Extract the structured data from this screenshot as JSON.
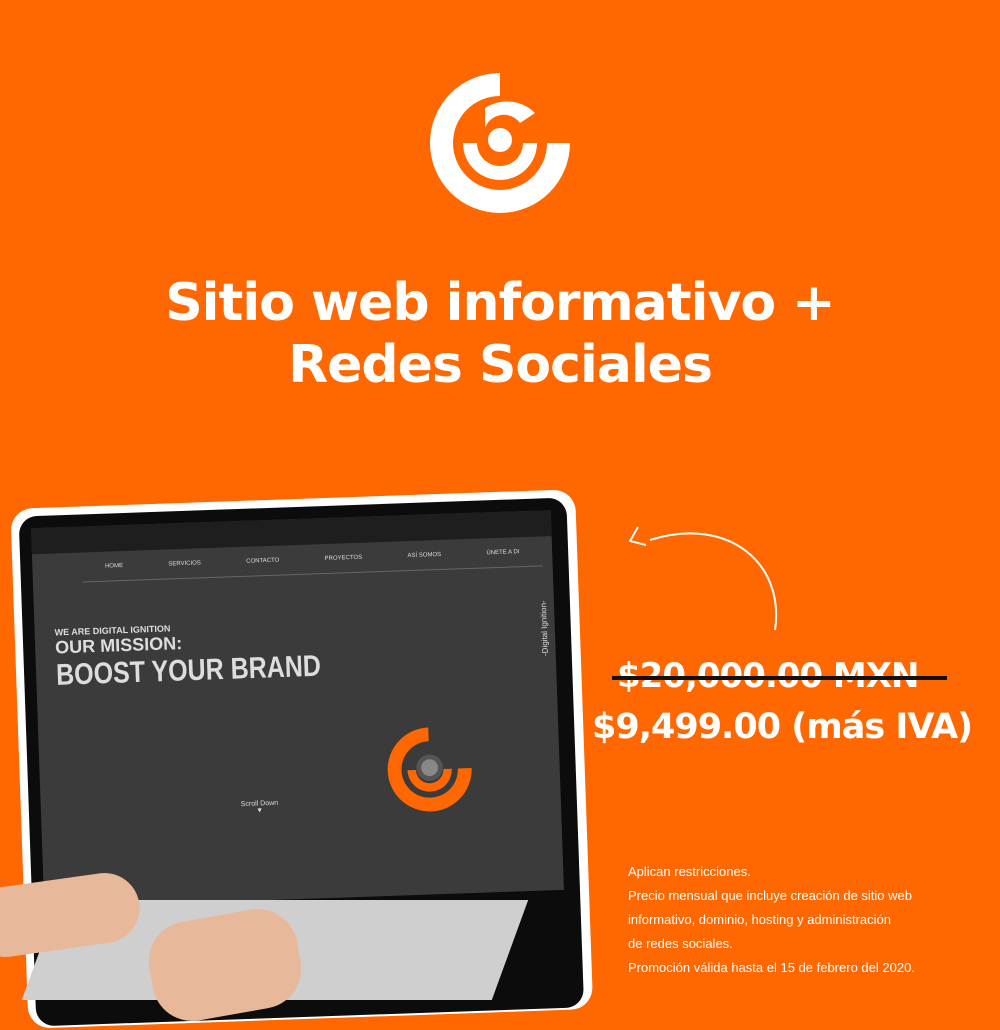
{
  "brand": {
    "color": "#ff6700",
    "logo": "digital-ignition-logo"
  },
  "headline": {
    "line1": "Sitio web informativo +",
    "line2": "Redes Sociales"
  },
  "laptop_site": {
    "nav": [
      "HOME",
      "SERVICIOS",
      "CONTACTO",
      "PROYECTOS",
      "ASÍ SOMOS",
      "ÚNETE A DI"
    ],
    "tagline": "WE ARE DIGITAL IGNITION",
    "mission": "OUR MISSION:",
    "slogan": "BOOST YOUR BRAND",
    "scroll": "Scroll Down",
    "side": "-Digital Ignition-"
  },
  "price": {
    "old": "$20,000.00 MXN",
    "new": "$9,499.00 (más IVA)"
  },
  "fine_print": [
    "Aplican restricciones.",
    "Precio mensual que incluye creación de sitio web",
    "informativo, dominio, hosting y administración",
    "de redes sociales.",
    "Promoción válida hasta el 15 de febrero del 2020."
  ]
}
